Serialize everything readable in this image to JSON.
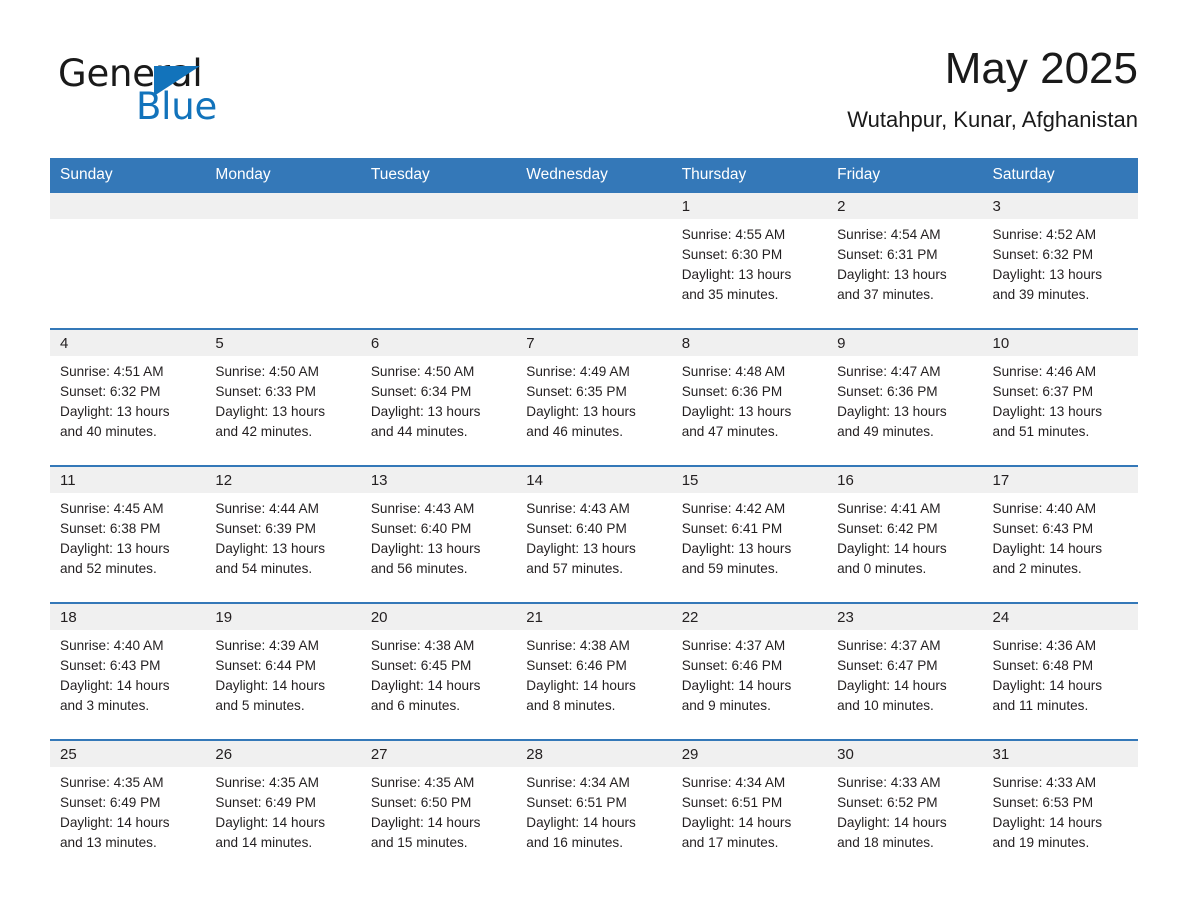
{
  "brand": {
    "name_part1": "General",
    "name_part2": "Blue",
    "triangle_color": "#1273bb",
    "text_color": "#1a1a1a"
  },
  "header": {
    "title": "May 2025",
    "subtitle": "Wutahpur, Kunar, Afghanistan"
  },
  "theme": {
    "header_blue": "#3478b8",
    "daynum_band": "#f0f0f0",
    "text": "#231f20",
    "page_background": "#ffffff"
  },
  "calendar": {
    "weekday_headers": [
      "Sunday",
      "Monday",
      "Tuesday",
      "Wednesday",
      "Thursday",
      "Friday",
      "Saturday"
    ],
    "weeks": [
      [
        {
          "day": "",
          "lines": []
        },
        {
          "day": "",
          "lines": []
        },
        {
          "day": "",
          "lines": []
        },
        {
          "day": "",
          "lines": []
        },
        {
          "day": "1",
          "lines": [
            "Sunrise: 4:55 AM",
            "Sunset: 6:30 PM",
            "Daylight: 13 hours",
            "and 35 minutes."
          ]
        },
        {
          "day": "2",
          "lines": [
            "Sunrise: 4:54 AM",
            "Sunset: 6:31 PM",
            "Daylight: 13 hours",
            "and 37 minutes."
          ]
        },
        {
          "day": "3",
          "lines": [
            "Sunrise: 4:52 AM",
            "Sunset: 6:32 PM",
            "Daylight: 13 hours",
            "and 39 minutes."
          ]
        }
      ],
      [
        {
          "day": "4",
          "lines": [
            "Sunrise: 4:51 AM",
            "Sunset: 6:32 PM",
            "Daylight: 13 hours",
            "and 40 minutes."
          ]
        },
        {
          "day": "5",
          "lines": [
            "Sunrise: 4:50 AM",
            "Sunset: 6:33 PM",
            "Daylight: 13 hours",
            "and 42 minutes."
          ]
        },
        {
          "day": "6",
          "lines": [
            "Sunrise: 4:50 AM",
            "Sunset: 6:34 PM",
            "Daylight: 13 hours",
            "and 44 minutes."
          ]
        },
        {
          "day": "7",
          "lines": [
            "Sunrise: 4:49 AM",
            "Sunset: 6:35 PM",
            "Daylight: 13 hours",
            "and 46 minutes."
          ]
        },
        {
          "day": "8",
          "lines": [
            "Sunrise: 4:48 AM",
            "Sunset: 6:36 PM",
            "Daylight: 13 hours",
            "and 47 minutes."
          ]
        },
        {
          "day": "9",
          "lines": [
            "Sunrise: 4:47 AM",
            "Sunset: 6:36 PM",
            "Daylight: 13 hours",
            "and 49 minutes."
          ]
        },
        {
          "day": "10",
          "lines": [
            "Sunrise: 4:46 AM",
            "Sunset: 6:37 PM",
            "Daylight: 13 hours",
            "and 51 minutes."
          ]
        }
      ],
      [
        {
          "day": "11",
          "lines": [
            "Sunrise: 4:45 AM",
            "Sunset: 6:38 PM",
            "Daylight: 13 hours",
            "and 52 minutes."
          ]
        },
        {
          "day": "12",
          "lines": [
            "Sunrise: 4:44 AM",
            "Sunset: 6:39 PM",
            "Daylight: 13 hours",
            "and 54 minutes."
          ]
        },
        {
          "day": "13",
          "lines": [
            "Sunrise: 4:43 AM",
            "Sunset: 6:40 PM",
            "Daylight: 13 hours",
            "and 56 minutes."
          ]
        },
        {
          "day": "14",
          "lines": [
            "Sunrise: 4:43 AM",
            "Sunset: 6:40 PM",
            "Daylight: 13 hours",
            "and 57 minutes."
          ]
        },
        {
          "day": "15",
          "lines": [
            "Sunrise: 4:42 AM",
            "Sunset: 6:41 PM",
            "Daylight: 13 hours",
            "and 59 minutes."
          ]
        },
        {
          "day": "16",
          "lines": [
            "Sunrise: 4:41 AM",
            "Sunset: 6:42 PM",
            "Daylight: 14 hours",
            "and 0 minutes."
          ]
        },
        {
          "day": "17",
          "lines": [
            "Sunrise: 4:40 AM",
            "Sunset: 6:43 PM",
            "Daylight: 14 hours",
            "and 2 minutes."
          ]
        }
      ],
      [
        {
          "day": "18",
          "lines": [
            "Sunrise: 4:40 AM",
            "Sunset: 6:43 PM",
            "Daylight: 14 hours",
            "and 3 minutes."
          ]
        },
        {
          "day": "19",
          "lines": [
            "Sunrise: 4:39 AM",
            "Sunset: 6:44 PM",
            "Daylight: 14 hours",
            "and 5 minutes."
          ]
        },
        {
          "day": "20",
          "lines": [
            "Sunrise: 4:38 AM",
            "Sunset: 6:45 PM",
            "Daylight: 14 hours",
            "and 6 minutes."
          ]
        },
        {
          "day": "21",
          "lines": [
            "Sunrise: 4:38 AM",
            "Sunset: 6:46 PM",
            "Daylight: 14 hours",
            "and 8 minutes."
          ]
        },
        {
          "day": "22",
          "lines": [
            "Sunrise: 4:37 AM",
            "Sunset: 6:46 PM",
            "Daylight: 14 hours",
            "and 9 minutes."
          ]
        },
        {
          "day": "23",
          "lines": [
            "Sunrise: 4:37 AM",
            "Sunset: 6:47 PM",
            "Daylight: 14 hours",
            "and 10 minutes."
          ]
        },
        {
          "day": "24",
          "lines": [
            "Sunrise: 4:36 AM",
            "Sunset: 6:48 PM",
            "Daylight: 14 hours",
            "and 11 minutes."
          ]
        }
      ],
      [
        {
          "day": "25",
          "lines": [
            "Sunrise: 4:35 AM",
            "Sunset: 6:49 PM",
            "Daylight: 14 hours",
            "and 13 minutes."
          ]
        },
        {
          "day": "26",
          "lines": [
            "Sunrise: 4:35 AM",
            "Sunset: 6:49 PM",
            "Daylight: 14 hours",
            "and 14 minutes."
          ]
        },
        {
          "day": "27",
          "lines": [
            "Sunrise: 4:35 AM",
            "Sunset: 6:50 PM",
            "Daylight: 14 hours",
            "and 15 minutes."
          ]
        },
        {
          "day": "28",
          "lines": [
            "Sunrise: 4:34 AM",
            "Sunset: 6:51 PM",
            "Daylight: 14 hours",
            "and 16 minutes."
          ]
        },
        {
          "day": "29",
          "lines": [
            "Sunrise: 4:34 AM",
            "Sunset: 6:51 PM",
            "Daylight: 14 hours",
            "and 17 minutes."
          ]
        },
        {
          "day": "30",
          "lines": [
            "Sunrise: 4:33 AM",
            "Sunset: 6:52 PM",
            "Daylight: 14 hours",
            "and 18 minutes."
          ]
        },
        {
          "day": "31",
          "lines": [
            "Sunrise: 4:33 AM",
            "Sunset: 6:53 PM",
            "Daylight: 14 hours",
            "and 19 minutes."
          ]
        }
      ]
    ]
  }
}
